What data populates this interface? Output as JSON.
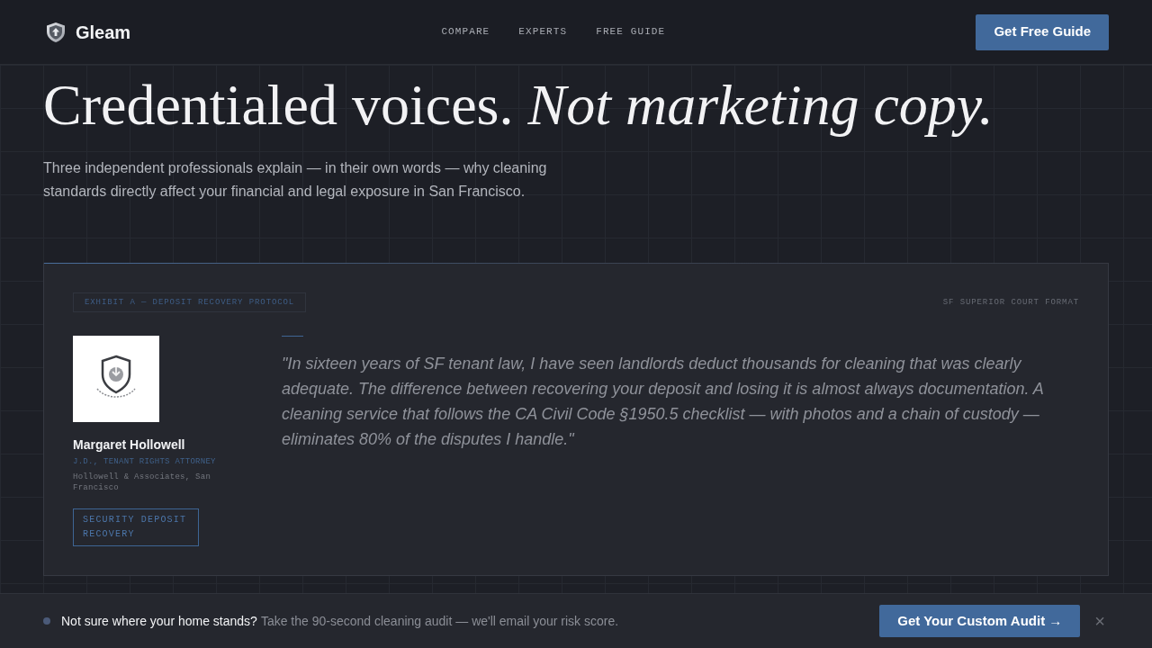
{
  "header": {
    "brand": "Gleam",
    "nav": [
      "COMPARE",
      "EXPERTS",
      "FREE GUIDE"
    ],
    "cta": "Get Free Guide"
  },
  "hero": {
    "title": "Credentialed voices. *Not marketing copy.*",
    "intro": "Three independent professionals explain — in their own words — why cleaning standards directly affect your financial and legal exposure in San Francisco."
  },
  "exhibit": {
    "label": "EXHIBIT A — DEPOSIT RECOVERY PROTOCOL",
    "format": "SF SUPERIOR COURT FORMAT",
    "expert": {
      "name": "Margaret Hollowell",
      "credential": "J.D., TENANT RIGHTS ATTORNEY",
      "firm": "Hollowell & Associates, San Francisco",
      "tag": "SECURITY DEPOSIT RECOVERY"
    },
    "quote": "\"In sixteen years of SF tenant law, I have seen landlords deduct thousands for cleaning that was clearly adequate. The difference between recovering your deposit and losing it is almost always documentation. A cleaning service that follows the CA Civil Code §1950.5 checklist — with photos and a chain of custody — eliminates 80% of the disputes I handle.\""
  },
  "banner": {
    "question": "Not sure where your home stands?",
    "prompt": "Take the 90-second cleaning audit — we'll email your risk score.",
    "button": "Get Your Custom Audit →",
    "close": "×"
  }
}
